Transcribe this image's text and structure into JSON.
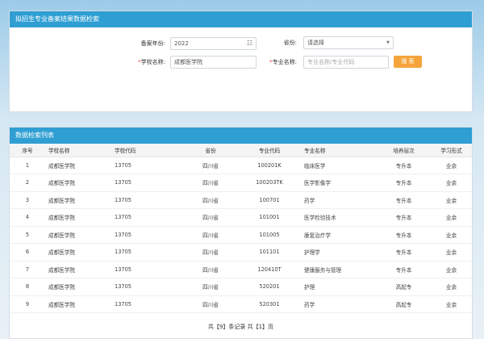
{
  "search": {
    "title": "拟招生专业备案结果数据检索",
    "year_label": "备案年份:",
    "year_value": "2022",
    "province_label": "省份:",
    "province_value": "请选择",
    "school_label": "学校名称:",
    "school_value": "成都医学院",
    "major_label": "专业名称:",
    "major_placeholder": "专业名称/专业代码",
    "search_button": "搜 索",
    "required_mark": "*"
  },
  "results": {
    "title": "数据检索列表",
    "columns": [
      "序号",
      "学校名称",
      "学校代码",
      "省份",
      "专业代码",
      "专业名称",
      "培养层次",
      "学习形式"
    ],
    "rows": [
      [
        "1",
        "成都医学院",
        "13705",
        "四川省",
        "100201K",
        "临床医学",
        "专升本",
        "业余"
      ],
      [
        "2",
        "成都医学院",
        "13705",
        "四川省",
        "100203TK",
        "医学影像学",
        "专升本",
        "业余"
      ],
      [
        "3",
        "成都医学院",
        "13705",
        "四川省",
        "100701",
        "药学",
        "专升本",
        "业余"
      ],
      [
        "4",
        "成都医学院",
        "13705",
        "四川省",
        "101001",
        "医学检验技术",
        "专升本",
        "业余"
      ],
      [
        "5",
        "成都医学院",
        "13705",
        "四川省",
        "101005",
        "康复治疗学",
        "专升本",
        "业余"
      ],
      [
        "6",
        "成都医学院",
        "13705",
        "四川省",
        "101101",
        "护理学",
        "专升本",
        "业余"
      ],
      [
        "7",
        "成都医学院",
        "13705",
        "四川省",
        "120410T",
        "健康服务与管理",
        "专升本",
        "业余"
      ],
      [
        "8",
        "成都医学院",
        "13705",
        "四川省",
        "520201",
        "护理",
        "高起专",
        "业余"
      ],
      [
        "9",
        "成都医学院",
        "13705",
        "四川省",
        "520301",
        "药学",
        "高起专",
        "业余"
      ]
    ],
    "pager_text": "共【9】条记录 共【1】页"
  },
  "icons": {
    "calendar": "calendar-icon",
    "dropdown": "dropdown-arrow-icon"
  },
  "colors": {
    "header_bg": "#2f9fd3",
    "search_button_bg": "#f5a43b",
    "required": "#e23b3b"
  }
}
